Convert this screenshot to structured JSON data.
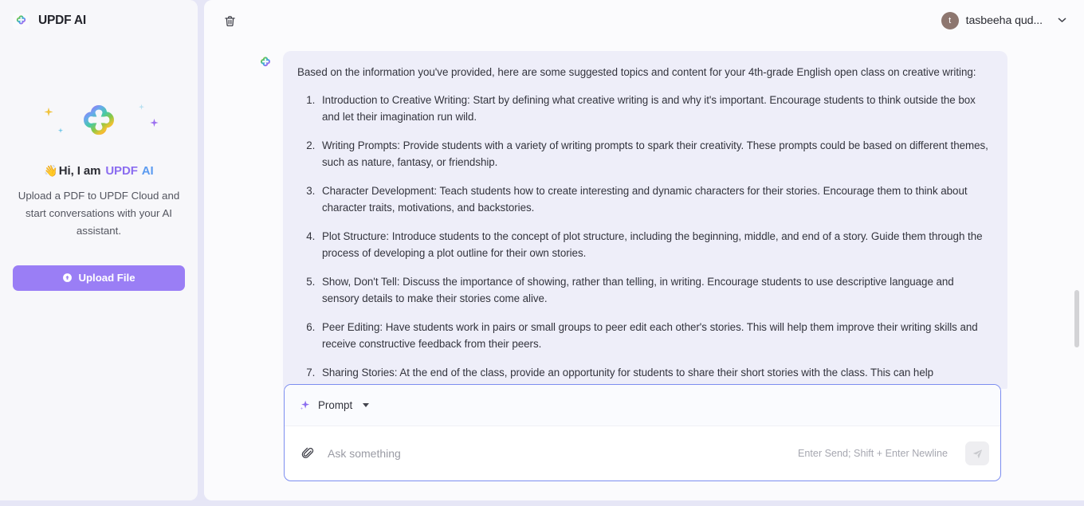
{
  "sidebar": {
    "brand": "UPDF AI",
    "logo_icon": "updf-clover-logo-icon",
    "hero_icon": "updf-clover-logo-large-icon",
    "greeting_wave": "👋",
    "greeting_prefix": "Hi, I am",
    "greeting_brand_updf": "UPDF",
    "greeting_brand_ai": "AI",
    "description": "Upload a PDF to UPDF Cloud and start conversations with your AI assistant.",
    "upload_button": "Upload File",
    "upload_icon": "upload-circle-icon",
    "accent": "#9a7ef5"
  },
  "header": {
    "delete_icon": "trash-icon",
    "user_initial": "t",
    "user_name": "tasbeeha qud...",
    "caret_icon": "chevron-down-icon",
    "avatar_color": "#8d766f"
  },
  "message": {
    "avatar_icon": "updf-clover-logo-icon",
    "intro": "Based on the information you've provided, here are some suggested topics and content for your 4th-grade English open class on creative writing:",
    "items": [
      "Introduction to Creative Writing: Start by defining what creative writing is and why it's important. Encourage students to think outside the box and let their imagination run wild.",
      "Writing Prompts: Provide students with a variety of writing prompts to spark their creativity. These prompts could be based on different themes, such as nature, fantasy, or friendship.",
      "Character Development: Teach students how to create interesting and dynamic characters for their stories. Encourage them to think about character traits, motivations, and backstories.",
      "Plot Structure: Introduce students to the concept of plot structure, including the beginning, middle, and end of a story. Guide them through the process of developing a plot outline for their own stories.",
      "Show, Don't Tell: Discuss the importance of showing, rather than telling, in writing. Encourage students to use descriptive language and sensory details to make their stories come alive.",
      "Peer Editing: Have students work in pairs or small groups to peer edit each other's stories. This will help them improve their writing skills and receive constructive feedback from their peers.",
      "Sharing Stories: At the end of the class, provide an opportunity for students to share their short stories with the class. This can help"
    ],
    "bubble_color": "#eeeef9"
  },
  "composer": {
    "prompt_label": "Prompt",
    "prompt_icon": "sparkle-icon",
    "dropdown_icon": "caret-down-icon",
    "attach_icon": "paperclip-icon",
    "input_value": "",
    "input_placeholder": "Ask something",
    "hint": "Enter Send; Shift + Enter Newline",
    "send_icon": "send-plane-icon",
    "border_color": "#7c8df0"
  }
}
